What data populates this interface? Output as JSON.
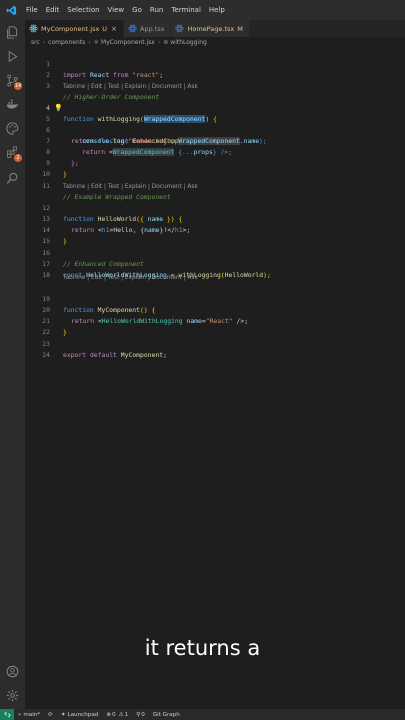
{
  "menu": [
    "File",
    "Edit",
    "Selection",
    "View",
    "Go",
    "Run",
    "Terminal",
    "Help"
  ],
  "tabs": [
    {
      "label": "MyComponent.jsx",
      "status": "U",
      "close": "×"
    },
    {
      "label": "App.tsx",
      "status": "",
      "close": ""
    },
    {
      "label": "HomePage.tsx",
      "status": "M",
      "close": ""
    }
  ],
  "breadcrumb": [
    "src",
    "components",
    "MyComponent.jsx",
    "withLogging"
  ],
  "activity": {
    "scm_badge": "14",
    "ext_badge": "2"
  },
  "codelens": "Tabnine | Edit | Test | Explain | Document | Ask",
  "lines": {
    "l1": {
      "num": "1",
      "parts": [
        "import",
        " React ",
        "from",
        " ",
        "\"react\"",
        ";"
      ]
    },
    "l2": {
      "num": "2"
    },
    "l3": {
      "num": "3",
      "text": "// Higher-Order Component"
    },
    "l4": {
      "num": "4",
      "parts": [
        "function",
        " ",
        "withLogging",
        "(",
        "WrappedComponent",
        ") {"
      ]
    },
    "l5": {
      "num": "5",
      "parts": [
        "return",
        " ",
        "function",
        " ",
        "EnhancedComponent",
        "(",
        "props",
        ") {"
      ]
    },
    "l6": {
      "num": "6",
      "parts": [
        "console",
        ".",
        "log",
        "(",
        "\"Rendering\"",
        ", ",
        "WrappedComponent",
        ".",
        "name",
        ");"
      ]
    },
    "l7": {
      "num": "7",
      "parts": [
        "return",
        " <",
        "WrappedComponent",
        " {...",
        "props",
        "} />;"
      ]
    },
    "l8": {
      "num": "8",
      "text": "};"
    },
    "l9": {
      "num": "9",
      "text": "}"
    },
    "l10": {
      "num": "10"
    },
    "l11": {
      "num": "11",
      "text": "// Example Wrapped Component"
    },
    "l12": {
      "num": "12",
      "parts": [
        "function",
        " ",
        "HelloWorld",
        "({ ",
        "name",
        " }) {"
      ]
    },
    "l13": {
      "num": "13",
      "parts": [
        "return",
        " <",
        "h1",
        ">Hello, {",
        "name",
        "}!</",
        "h1",
        ">;"
      ]
    },
    "l14": {
      "num": "14",
      "text": "}"
    },
    "l15": {
      "num": "15"
    },
    "l16": {
      "num": "16",
      "text": "// Enhanced Component"
    },
    "l17": {
      "num": "17",
      "parts": [
        "const",
        " ",
        "HelloWorldWithLogging",
        " = ",
        "withLogging",
        "(",
        "HelloWorld",
        ");"
      ]
    },
    "l18": {
      "num": "18"
    },
    "l19": {
      "num": "19",
      "parts": [
        "function",
        " ",
        "MyComponent",
        "() {"
      ]
    },
    "l20": {
      "num": "20",
      "parts": [
        "return",
        " <",
        "HelloWorldWithLogging",
        " ",
        "name",
        "=",
        "\"React\"",
        " />;"
      ]
    },
    "l21": {
      "num": "21",
      "text": "}"
    },
    "l22": {
      "num": "22"
    },
    "l23": {
      "num": "23",
      "parts": [
        "export",
        " ",
        "default",
        " ",
        "MyComponent",
        ";"
      ]
    },
    "l24": {
      "num": "24"
    }
  },
  "subtitle": "it returns a",
  "status": {
    "branch": "main*",
    "launchpad": "Launchpad",
    "errors": "0",
    "warnings": "1",
    "ports": "0",
    "git_graph": "Git Graph"
  }
}
